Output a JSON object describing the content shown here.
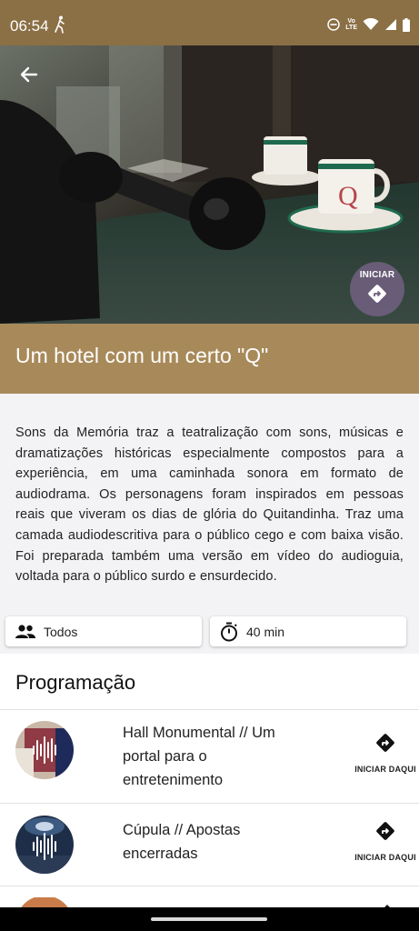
{
  "status_bar": {
    "time": "06:54",
    "network_label_top": "Vo",
    "network_label_bottom": "LTE",
    "icons": [
      "walking-icon",
      "do-not-disturb-icon",
      "volte-icon",
      "wifi-icon",
      "cell-signal-icon",
      "battery-icon"
    ]
  },
  "hero": {
    "back_icon": "arrow-back-icon",
    "start_button_label": "INICIAR",
    "start_icon": "directions-icon"
  },
  "title": "Um hotel com um certo \"Q\"",
  "description": "Sons da Memória traz a teatralização com sons, músicas e dramatizações históricas especialmente compostos para a experiência, em uma caminhada sonora em formato de audiodrama. Os personagens foram inspirados em pessoas reais que viveram os dias de glória do Quitandinha. Traz uma camada audiodescritiva para o público cego e com baixa visão. Foi preparada também uma versão em vídeo do audioguia, voltada para o público surdo e ensurdecido.",
  "chips": {
    "audience": {
      "icon": "people-icon",
      "label": "Todos"
    },
    "duration": {
      "icon": "timer-icon",
      "label": "40 min"
    }
  },
  "program": {
    "heading": "Programação",
    "items": [
      {
        "title": "Hall Monumental // Um portal para o entretenimento",
        "action_label": "INICIAR DAQUI",
        "action_icon": "directions-icon"
      },
      {
        "title": "Cúpula // Apostas encerradas",
        "action_label": "INICIAR DAQUI",
        "action_icon": "directions-icon"
      }
    ]
  },
  "colors": {
    "status_bar": "#8b6f45",
    "title_band": "#a88a5a",
    "fab": "#706080"
  }
}
